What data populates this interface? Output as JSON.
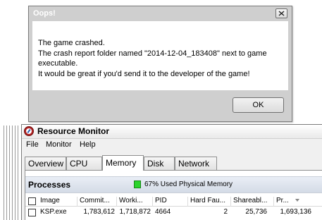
{
  "dialog": {
    "title": "Oops!",
    "lines": [
      "The game crashed.",
      "The crash report folder named \"2014-12-04_183408\" next to game",
      "executable.",
      "It would be great if you'd send it to the developer of the game!"
    ],
    "ok_label": "OK",
    "close_icon": "close-icon"
  },
  "resource_monitor": {
    "title": "Resource Monitor",
    "menu": [
      "File",
      "Monitor",
      "Help"
    ],
    "tabs": [
      "Overview",
      "CPU",
      "Memory",
      "Disk",
      "Network"
    ],
    "active_tab": "Memory",
    "processes_title": "Processes",
    "memory_usage_text": "67% Used Physical Memory",
    "memory_indicator_color": "#2bd42b",
    "columns": [
      "Image",
      "Commit...",
      "Worki...",
      "PID",
      "Hard Fau...",
      "Shareabl...",
      "Pr..."
    ],
    "rows": [
      {
        "image": "KSP.exe",
        "commit": "1,783,612",
        "working": "1,718,872",
        "pid": "4664",
        "hard_faults": "2",
        "shareable": "25,736",
        "private": "1,693,136"
      }
    ]
  }
}
